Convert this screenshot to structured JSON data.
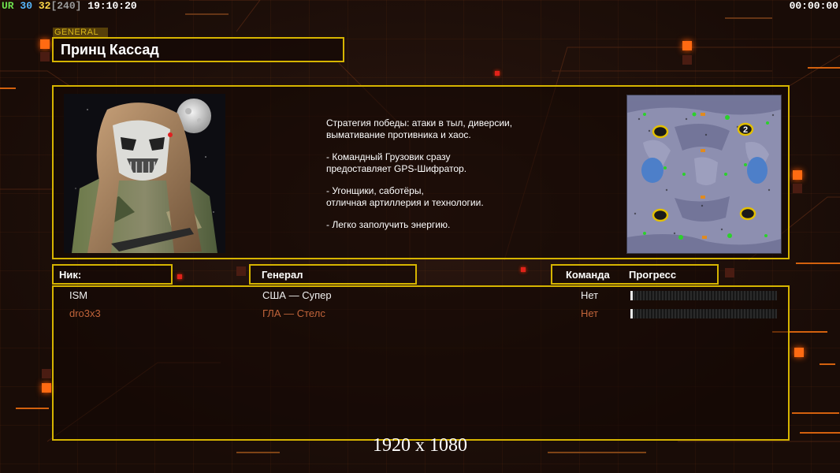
{
  "overlay": {
    "fps_a": "UR",
    "fps_b": "30",
    "fps_c": "32",
    "fps_d": "[240]",
    "clock": "19:10:20",
    "timer": "00:00:00"
  },
  "general": {
    "tag": "GENERAL",
    "name": "Принц Кассад",
    "description": [
      "Стратегия победы: атаки в тыл, диверсии,\n вымативание противника и хаос.",
      "- Командный Грузовик сразу\nпредоставляет GPS-Шифратор.",
      "- Угонщики, саботёры,\nотличная артиллерия и технологии.",
      "- Легко заполучить энергию."
    ]
  },
  "table": {
    "headers": {
      "nick": "Ник:",
      "general": "Генерал",
      "team": "Команда",
      "progress": "Прогресс"
    },
    "players": [
      {
        "nick": "ISM",
        "general": "США — Супер",
        "team": "Нет",
        "progress": 0.01
      },
      {
        "nick": "dro3x3",
        "general": "ГЛА — Стелс",
        "team": "Нет",
        "progress": 0.01
      }
    ]
  },
  "resolution": "1920 x 1080",
  "colors": {
    "frame": "#d6b400",
    "accent": "#ff6a12",
    "player1": "#f0f0f0",
    "player2": "#c1643a"
  },
  "minimap": {
    "start_position_label": "2"
  }
}
